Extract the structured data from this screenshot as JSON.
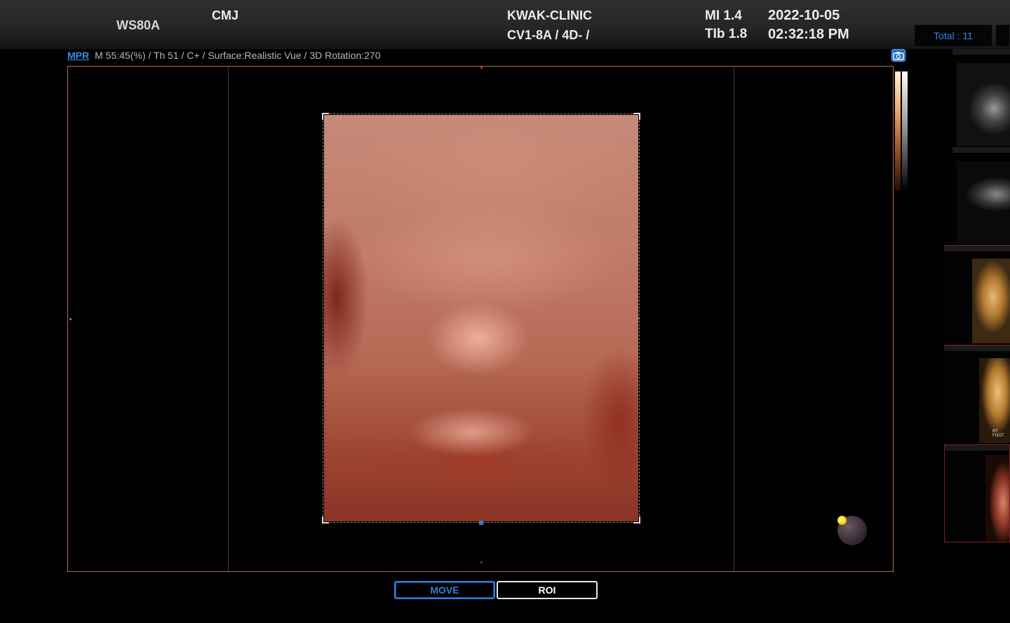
{
  "header": {
    "model": "WS80A",
    "operator": "CMJ",
    "clinic": "KWAK-CLINIC",
    "probe": "CV1-8A / 4D- /",
    "mi": "MI  1.4",
    "tib": "TIb 1.8",
    "date": "2022-10-05",
    "time": "02:32:18 PM",
    "total": "Total : 11"
  },
  "info": {
    "mode_link": "MPR",
    "params": "M 55:45(%) / Th 51 / C+ / Surface:Realistic Vue / 3D Rotation:270"
  },
  "buttons": {
    "move": "MOVE",
    "roi": "ROI"
  },
  "thumbnails": {
    "count": 5,
    "items": [
      {
        "style": "grayscale-2d"
      },
      {
        "style": "grayscale-2d"
      },
      {
        "style": "3d-amber"
      },
      {
        "style": "3d-amber",
        "label": "RT FOOT"
      },
      {
        "style": "3d-realistic"
      }
    ]
  },
  "colors": {
    "accent_blue": "#2f7ee0",
    "viewport_border": "#b86a52",
    "orientation_marker": "#f2d400"
  },
  "icons": {
    "camera": "camera-icon",
    "orientation": "orientation-ball-icon"
  }
}
